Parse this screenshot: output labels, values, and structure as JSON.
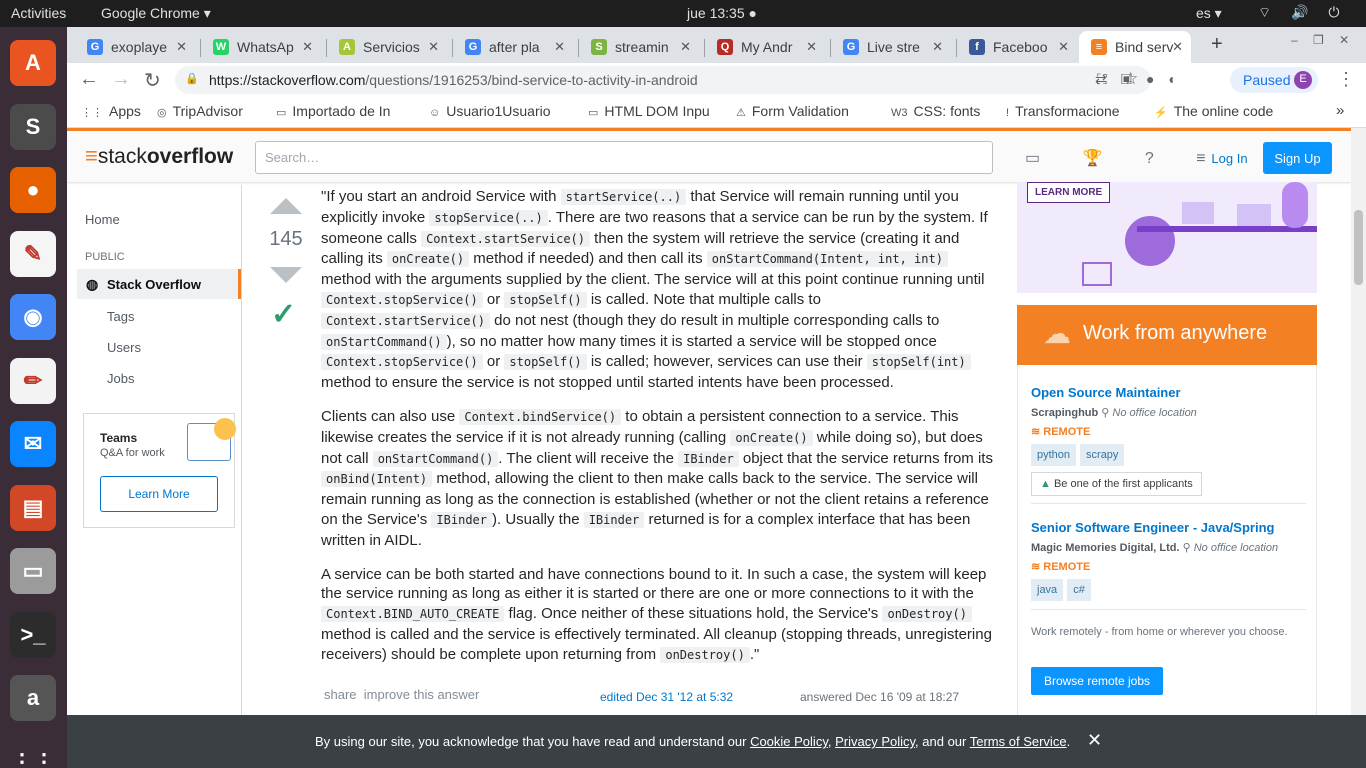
{
  "system_bar": {
    "activities": "Activities",
    "app": "Google Chrome ▾",
    "clock": "jue 13:35 ●",
    "lang": "es ▾",
    "tray": "⌔ 🔊 ⏻ ▾"
  },
  "dock": {
    "items": [
      {
        "name": "Ubuntu Software",
        "glyph": "A",
        "color": "#e95420"
      },
      {
        "name": "Sublime Text",
        "glyph": "S",
        "color": "#4b4b4b"
      },
      {
        "name": "Firefox",
        "glyph": "●",
        "color": "#e66000"
      },
      {
        "name": "Evince",
        "glyph": "✎",
        "color": "#f5f5f5"
      },
      {
        "name": "Chrome",
        "glyph": "◉",
        "color": "#4285f4"
      },
      {
        "name": "Text Editor",
        "glyph": "✏",
        "color": "#f3f3f3"
      },
      {
        "name": "Thunderbird",
        "glyph": "✉",
        "color": "#0a84ff"
      },
      {
        "name": "Impress",
        "glyph": "▤",
        "color": "#d24726"
      },
      {
        "name": "Files",
        "glyph": "▭",
        "color": "#9b9b9b"
      },
      {
        "name": "Terminal",
        "glyph": ">_",
        "color": "#2c2c2c"
      },
      {
        "name": "Amazon",
        "glyph": "a",
        "color": "#555"
      },
      {
        "name": "Show Apps",
        "glyph": "⋮⋮",
        "color": "#3a2d38"
      }
    ]
  },
  "tabs": [
    {
      "label": "exoplaye",
      "fav": "G",
      "favcolor": "#4285f4"
    },
    {
      "label": "WhatsAp",
      "fav": "W",
      "favcolor": "#25d366"
    },
    {
      "label": "Servicios",
      "fav": "A",
      "favcolor": "#a4c639"
    },
    {
      "label": "after pla",
      "fav": "G",
      "favcolor": "#4285f4"
    },
    {
      "label": "streamin",
      "fav": "S",
      "favcolor": "#7cb342"
    },
    {
      "label": "My Andr",
      "fav": "Q",
      "favcolor": "#b92b27"
    },
    {
      "label": "Live stre",
      "fav": "G",
      "favcolor": "#4285f4"
    },
    {
      "label": "Faceboo",
      "fav": "f",
      "favcolor": "#3b5998"
    },
    {
      "label": "Bind serv",
      "fav": "≡",
      "favcolor": "#f48024"
    }
  ],
  "new_tab": "+",
  "window_controls": "‒ ❐ ✕",
  "nav": {
    "back": "←",
    "forward": "→",
    "reload": "↻",
    "lock": "🔒",
    "url_host": "https://stackoverflow.com",
    "url_path": "/questions/1916253/bind-service-to-activity-in-android",
    "translate": "⇄",
    "star": "☆",
    "paused": "Paused",
    "avatar": "E",
    "menu": "⋮"
  },
  "bookmarks": [
    {
      "label": "Apps"
    },
    {
      "label": "TripAdvisor"
    },
    {
      "label": "Importado de In"
    },
    {
      "label": "Usuario1Usuario"
    },
    {
      "label": "HTML DOM Inpu"
    },
    {
      "label": "Form Validation"
    },
    {
      "label": "CSS: fonts"
    },
    {
      "label": "Transformacione"
    },
    {
      "label": "The online code"
    }
  ],
  "bookmarks_more": "»",
  "so": {
    "logo_light": "stack",
    "logo_bold": "overflow",
    "search_placeholder": "Search…",
    "header_icons": "▭ 🏆 ? ≡",
    "login": "Log In",
    "signup": "Sign Up"
  },
  "leftnav": {
    "home": "Home",
    "public": "PUBLIC",
    "stackoverflow": "Stack Overflow",
    "tags": "Tags",
    "users": "Users",
    "jobs": "Jobs",
    "teams_title": "Teams",
    "teams_sub": "Q&A for work",
    "learn_more": "Learn More"
  },
  "vote": {
    "score": "145"
  },
  "answer": {
    "p1": [
      "\"If you start an android Service with ",
      {
        "code": "startService(..)"
      },
      " that Service will remain running until you explicitly invoke ",
      {
        "code": "stopService(..)"
      },
      ". There are two reasons that a service can be run by the system. If someone calls ",
      {
        "code": "Context.startService()"
      },
      " then the system will retrieve the service (creating it and calling its ",
      {
        "code": "onCreate()"
      },
      " method if needed) and then call its ",
      {
        "code": "onStartCommand(Intent, int, int)"
      },
      " method with the arguments supplied by the client. The service will at this point continue running until ",
      {
        "code": "Context.stopService()"
      },
      " or ",
      {
        "code": "stopSelf()"
      },
      " is called. Note that multiple calls to ",
      {
        "code": "Context.startService()"
      },
      " do not nest (though they do result in multiple corresponding calls to ",
      {
        "code": "onStartCommand()"
      },
      "), so no matter how many times it is started a service will be stopped once ",
      {
        "code": "Context.stopService()"
      },
      " or ",
      {
        "code": "stopSelf()"
      },
      " is called; however, services can use their ",
      {
        "code": "stopSelf(int)"
      },
      " method to ensure the service is not stopped until started intents have been processed."
    ],
    "p2": [
      "Clients can also use ",
      {
        "code": "Context.bindService()"
      },
      " to obtain a persistent connection to a service. This likewise creates the service if it is not already running (calling ",
      {
        "code": "onCreate()"
      },
      " while doing so), but does not call ",
      {
        "code": "onStartCommand()"
      },
      ". The client will receive the ",
      {
        "code": "IBinder"
      },
      " object that the service returns from its ",
      {
        "code": "onBind(Intent)"
      },
      " method, allowing the client to then make calls back to the service. The service will remain running as long as the connection is established (whether or not the client retains a reference on the Service's ",
      {
        "code": "IBinder"
      },
      "). Usually the ",
      {
        "code": "IBinder"
      },
      " returned is for a complex interface that has been written in AIDL."
    ],
    "p3": [
      "A service can be both started and have connections bound to it. In such a case, the system will keep the service running as long as either it is started or there are one or more connections to it with the ",
      {
        "code": "Context.BIND_AUTO_CREATE"
      },
      " flag. Once neither of these situations hold, the Service's ",
      {
        "code": "onDestroy()"
      },
      " method is called and the service is effectively terminated. All cleanup (stopping threads, unregistering receivers) should be complete upon returning from ",
      {
        "code": "onDestroy()"
      },
      ".\""
    ],
    "share": "share",
    "improve": "improve this answer",
    "edited": "edited Dec 31 '12 at 5:32",
    "answered": "answered Dec 16 '09 at 18:27"
  },
  "sidebar": {
    "ad_learn_more": "LEARN MORE",
    "work_from_anywhere": "Work from anywhere",
    "jobs": [
      {
        "title": "Open Source Maintainer",
        "company": "Scrapinghub",
        "location": "No office location",
        "remote": "REMOTE",
        "tags": [
          "python",
          "scrapy"
        ],
        "early": "Be one of the first applicants"
      },
      {
        "title": "Senior Software Engineer - Java/Spring",
        "company": "Magic Memories Digital, Ltd.",
        "location": "No office location",
        "remote": "REMOTE",
        "tags": [
          "java",
          "c#"
        ]
      }
    ],
    "remote_note": "Work remotely - from home or wherever you choose.",
    "browse": "Browse remote jobs"
  },
  "cookie": {
    "pre": "By using our site, you acknowledge that you have read and understand our ",
    "cookie_policy": "Cookie Policy",
    "sep1": ", ",
    "privacy_policy": "Privacy Policy",
    "sep2": ", and our ",
    "terms": "Terms of Service",
    "post": ".",
    "close": "✕"
  }
}
